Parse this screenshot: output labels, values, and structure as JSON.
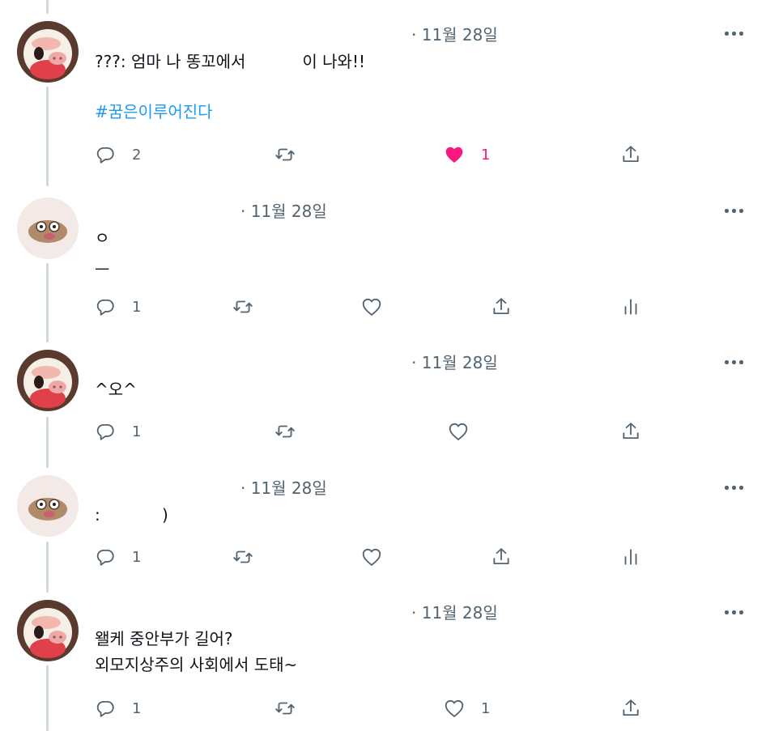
{
  "tweets": [
    {
      "date": "· 11월 28일",
      "lines": [
        "???: 엄마 나 똥꼬에서           이 나와!!"
      ],
      "hashtag": "#꿈은이루어진다",
      "reply_count": "2",
      "like_count": "1",
      "liked": true
    },
    {
      "date": "· 11월 28일",
      "lines": [
        "ㅇ",
        "ㅡ"
      ],
      "reply_count": "1"
    },
    {
      "date": "· 11월 28일",
      "lines": [
        "^오^"
      ],
      "reply_count": "1"
    },
    {
      "date": "· 11월 28일",
      "lines": [
        ":            )"
      ],
      "reply_count": "1"
    },
    {
      "date": "· 11월 28일",
      "lines": [
        "왤케 중안부가 길어?",
        "외모지상주의 사회에서 도태~"
      ],
      "reply_count": "1",
      "like_count": "1"
    }
  ],
  "colors": {
    "text": "#0f1419",
    "secondary": "#536471",
    "hashtag": "#1d9bf0",
    "like_active": "#f91880",
    "thread_line": "#cfd9de"
  },
  "icons": [
    "reply-icon",
    "retweet-icon",
    "like-icon",
    "share-icon",
    "analytics-icon",
    "more-icon"
  ]
}
